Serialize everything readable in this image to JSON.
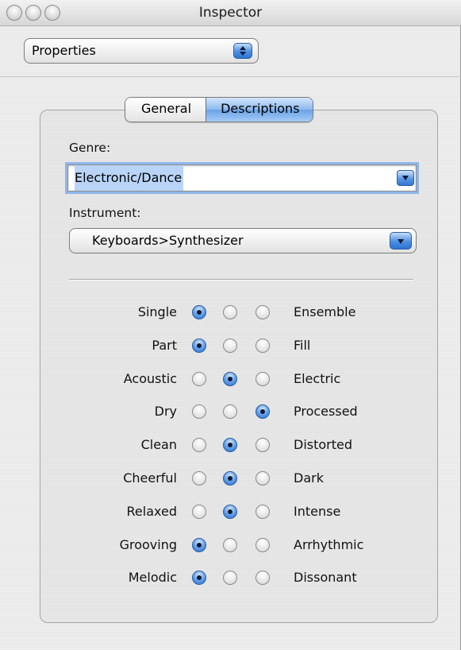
{
  "window": {
    "title": "Inspector"
  },
  "view_popup": {
    "value": "Properties"
  },
  "tabs": [
    {
      "label": "General",
      "selected": false
    },
    {
      "label": "Descriptions",
      "selected": true
    }
  ],
  "genre": {
    "label": "Genre:",
    "value": "Electronic/Dance"
  },
  "instrument": {
    "label": "Instrument:",
    "value": "Keyboards>Synthesizer"
  },
  "descriptors": [
    {
      "left": "Single",
      "right": "Ensemble",
      "selected": 0
    },
    {
      "left": "Part",
      "right": "Fill",
      "selected": 0
    },
    {
      "left": "Acoustic",
      "right": "Electric",
      "selected": 1
    },
    {
      "left": "Dry",
      "right": "Processed",
      "selected": 2
    },
    {
      "left": "Clean",
      "right": "Distorted",
      "selected": 1
    },
    {
      "left": "Cheerful",
      "right": "Dark",
      "selected": 1
    },
    {
      "left": "Relaxed",
      "right": "Intense",
      "selected": 1
    },
    {
      "left": "Grooving",
      "right": "Arrhythmic",
      "selected": 0
    },
    {
      "left": "Melodic",
      "right": "Dissonant",
      "selected": 0
    }
  ],
  "icons": {
    "close": "close-icon",
    "minimize": "minimize-icon",
    "zoom": "zoom-icon",
    "stepper": "up-down-stepper-icon",
    "dropdown": "chevron-down-icon"
  },
  "colors": {
    "accent": "#4b8ee2",
    "selection": "#b9d4f7"
  }
}
